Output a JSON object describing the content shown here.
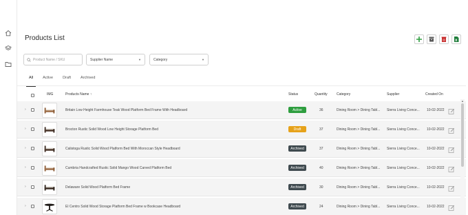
{
  "nav": {
    "items": [
      {
        "icon": "home-icon"
      },
      {
        "icon": "layers-icon"
      },
      {
        "icon": "folder-icon"
      }
    ]
  },
  "page": {
    "title": "Products List"
  },
  "toolbar": {
    "buttons": [
      {
        "icon": "add-icon",
        "color": "#2e9e3f"
      },
      {
        "icon": "archive-icon",
        "color": "#555555"
      },
      {
        "icon": "delete-icon",
        "color": "#c62828"
      },
      {
        "icon": "export-excel-icon",
        "color": "#1e7d3a"
      }
    ]
  },
  "filters": {
    "search_placeholder": "Product Name / SKU",
    "supplier_label": "Supplier Name",
    "category_label": "Category"
  },
  "tabs": [
    "All",
    "Active",
    "Draft",
    "Archived"
  ],
  "active_tab": "All",
  "table": {
    "headers": {
      "img": "IMG",
      "name": "Products Name",
      "sort_indicator": "↑",
      "status": "Status",
      "quantity": "Quantity",
      "category": "Category",
      "supplier": "Supplier",
      "created": "Created On"
    },
    "rows": [
      {
        "name": "Britain Low Height Farmhouse Teak Wood Platform Bed Frame With Headboard",
        "status": "Active",
        "quantity": "36",
        "category": "Dining Room > Dining Tabl...",
        "supplier": "Sierra Living Conce...",
        "created": "10-02-2022",
        "thumb_style": "bed-wood"
      },
      {
        "name": "Brocton Rustic Solid Wood Low Height Storage Platform Bed",
        "status": "Draft",
        "quantity": "37",
        "category": "Dining Room > Dining Tabl...",
        "supplier": "Sierra Living Conce...",
        "created": "10-02-2022",
        "thumb_style": "bed-dark"
      },
      {
        "name": "Calistoga Rustic Solid Wood Platform Bed With Moroccan Style Headboard",
        "status": "Archived",
        "quantity": "37",
        "category": "Dining Room > Dining Tabl...",
        "supplier": "Sierra Living Conce...",
        "created": "10-02-2022",
        "thumb_style": "bed-dark"
      },
      {
        "name": "Cumbria Handcrafted Rustic Solid Mango Wood Carved Platform Bed",
        "status": "Archived",
        "quantity": "40",
        "category": "Dining Room > Dining Tabl...",
        "supplier": "Sierra Living Conce...",
        "created": "10-02-2022",
        "thumb_style": "bed-wood"
      },
      {
        "name": "Delaware Solid Wood Platform Bed Frame",
        "status": "Archived",
        "quantity": "30",
        "category": "Dining Room > Dining Tabl...",
        "supplier": "Sierra Living Conce...",
        "created": "10-02-2022",
        "thumb_style": "bed-dark"
      },
      {
        "name": "El Centro Solid Wood Storage Platform Bed Frame w Bookcase Headboard",
        "status": "Archived",
        "quantity": "24",
        "category": "Dining Room > Dining Tabl...",
        "supplier": "Sierra Living Conce...",
        "created": "10-02-2022",
        "thumb_style": "table-dark"
      }
    ]
  },
  "status_colors": {
    "Active": "#2e9e3f",
    "Draft": "#e6a21a",
    "Archived": "#3f4a4f"
  }
}
